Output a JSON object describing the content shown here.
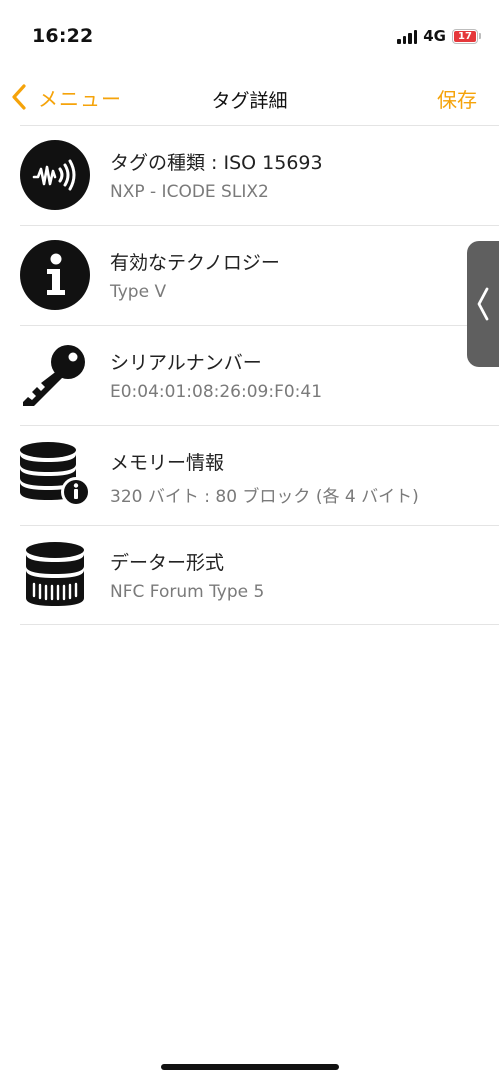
{
  "status_bar": {
    "time": "16:22",
    "network": "4G",
    "battery_level": "17"
  },
  "nav": {
    "back_label": "メニュー",
    "title": "タグ詳細",
    "save_label": "保存"
  },
  "rows": [
    {
      "icon": "nfc-wave-icon",
      "title": "タグの種類 : ISO 15693",
      "subtitle": "NXP - ICODE SLIX2"
    },
    {
      "icon": "info-icon",
      "title": "有効なテクノロジー",
      "subtitle": "Type V"
    },
    {
      "icon": "key-icon",
      "title": "シリアルナンバー",
      "subtitle": "E0:04:01:08:26:09:F0:41"
    },
    {
      "icon": "database-info-icon",
      "title": "メモリー情報",
      "subtitle": "320 バイト : 80 ブロック (各 4 バイト)"
    },
    {
      "icon": "database-format-icon",
      "title": "データー形式",
      "subtitle": "NFC Forum Type 5"
    }
  ],
  "colors": {
    "accent": "#f5a30a",
    "battery_low": "#e5383b",
    "divider": "#e4e4e4",
    "subtitle_text": "#7a7a7a"
  }
}
